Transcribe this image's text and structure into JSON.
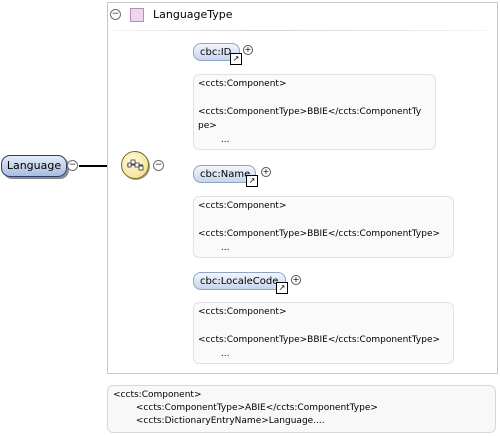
{
  "complex_type": {
    "name": "LanguageType",
    "collapse_symbol": "−"
  },
  "root_element": {
    "label": "Language",
    "collapse_symbol": "−"
  },
  "sequence": {
    "collapse_symbol": "−"
  },
  "children": [
    {
      "label": "cbc:ID",
      "expand_symbol": "+",
      "doc": "<ccts:Component>\n\n<ccts:ComponentType>BBIE</ccts:ComponentTy\npe>\n        ..."
    },
    {
      "label": "cbc:Name",
      "expand_symbol": "+",
      "doc": "<ccts:Component>\n\n<ccts:ComponentType>BBIE</ccts:ComponentType>\n        ..."
    },
    {
      "label": "cbc:LocaleCode",
      "expand_symbol": "+",
      "doc": "<ccts:Component>\n\n<ccts:ComponentType>BBIE</ccts:ComponentType>\n        ..."
    }
  ],
  "type_doc": "<ccts:Component>\n        <ccts:ComponentType>ABIE</ccts:ComponentType>\n        <ccts:DictionaryEntryName>Language...."
}
